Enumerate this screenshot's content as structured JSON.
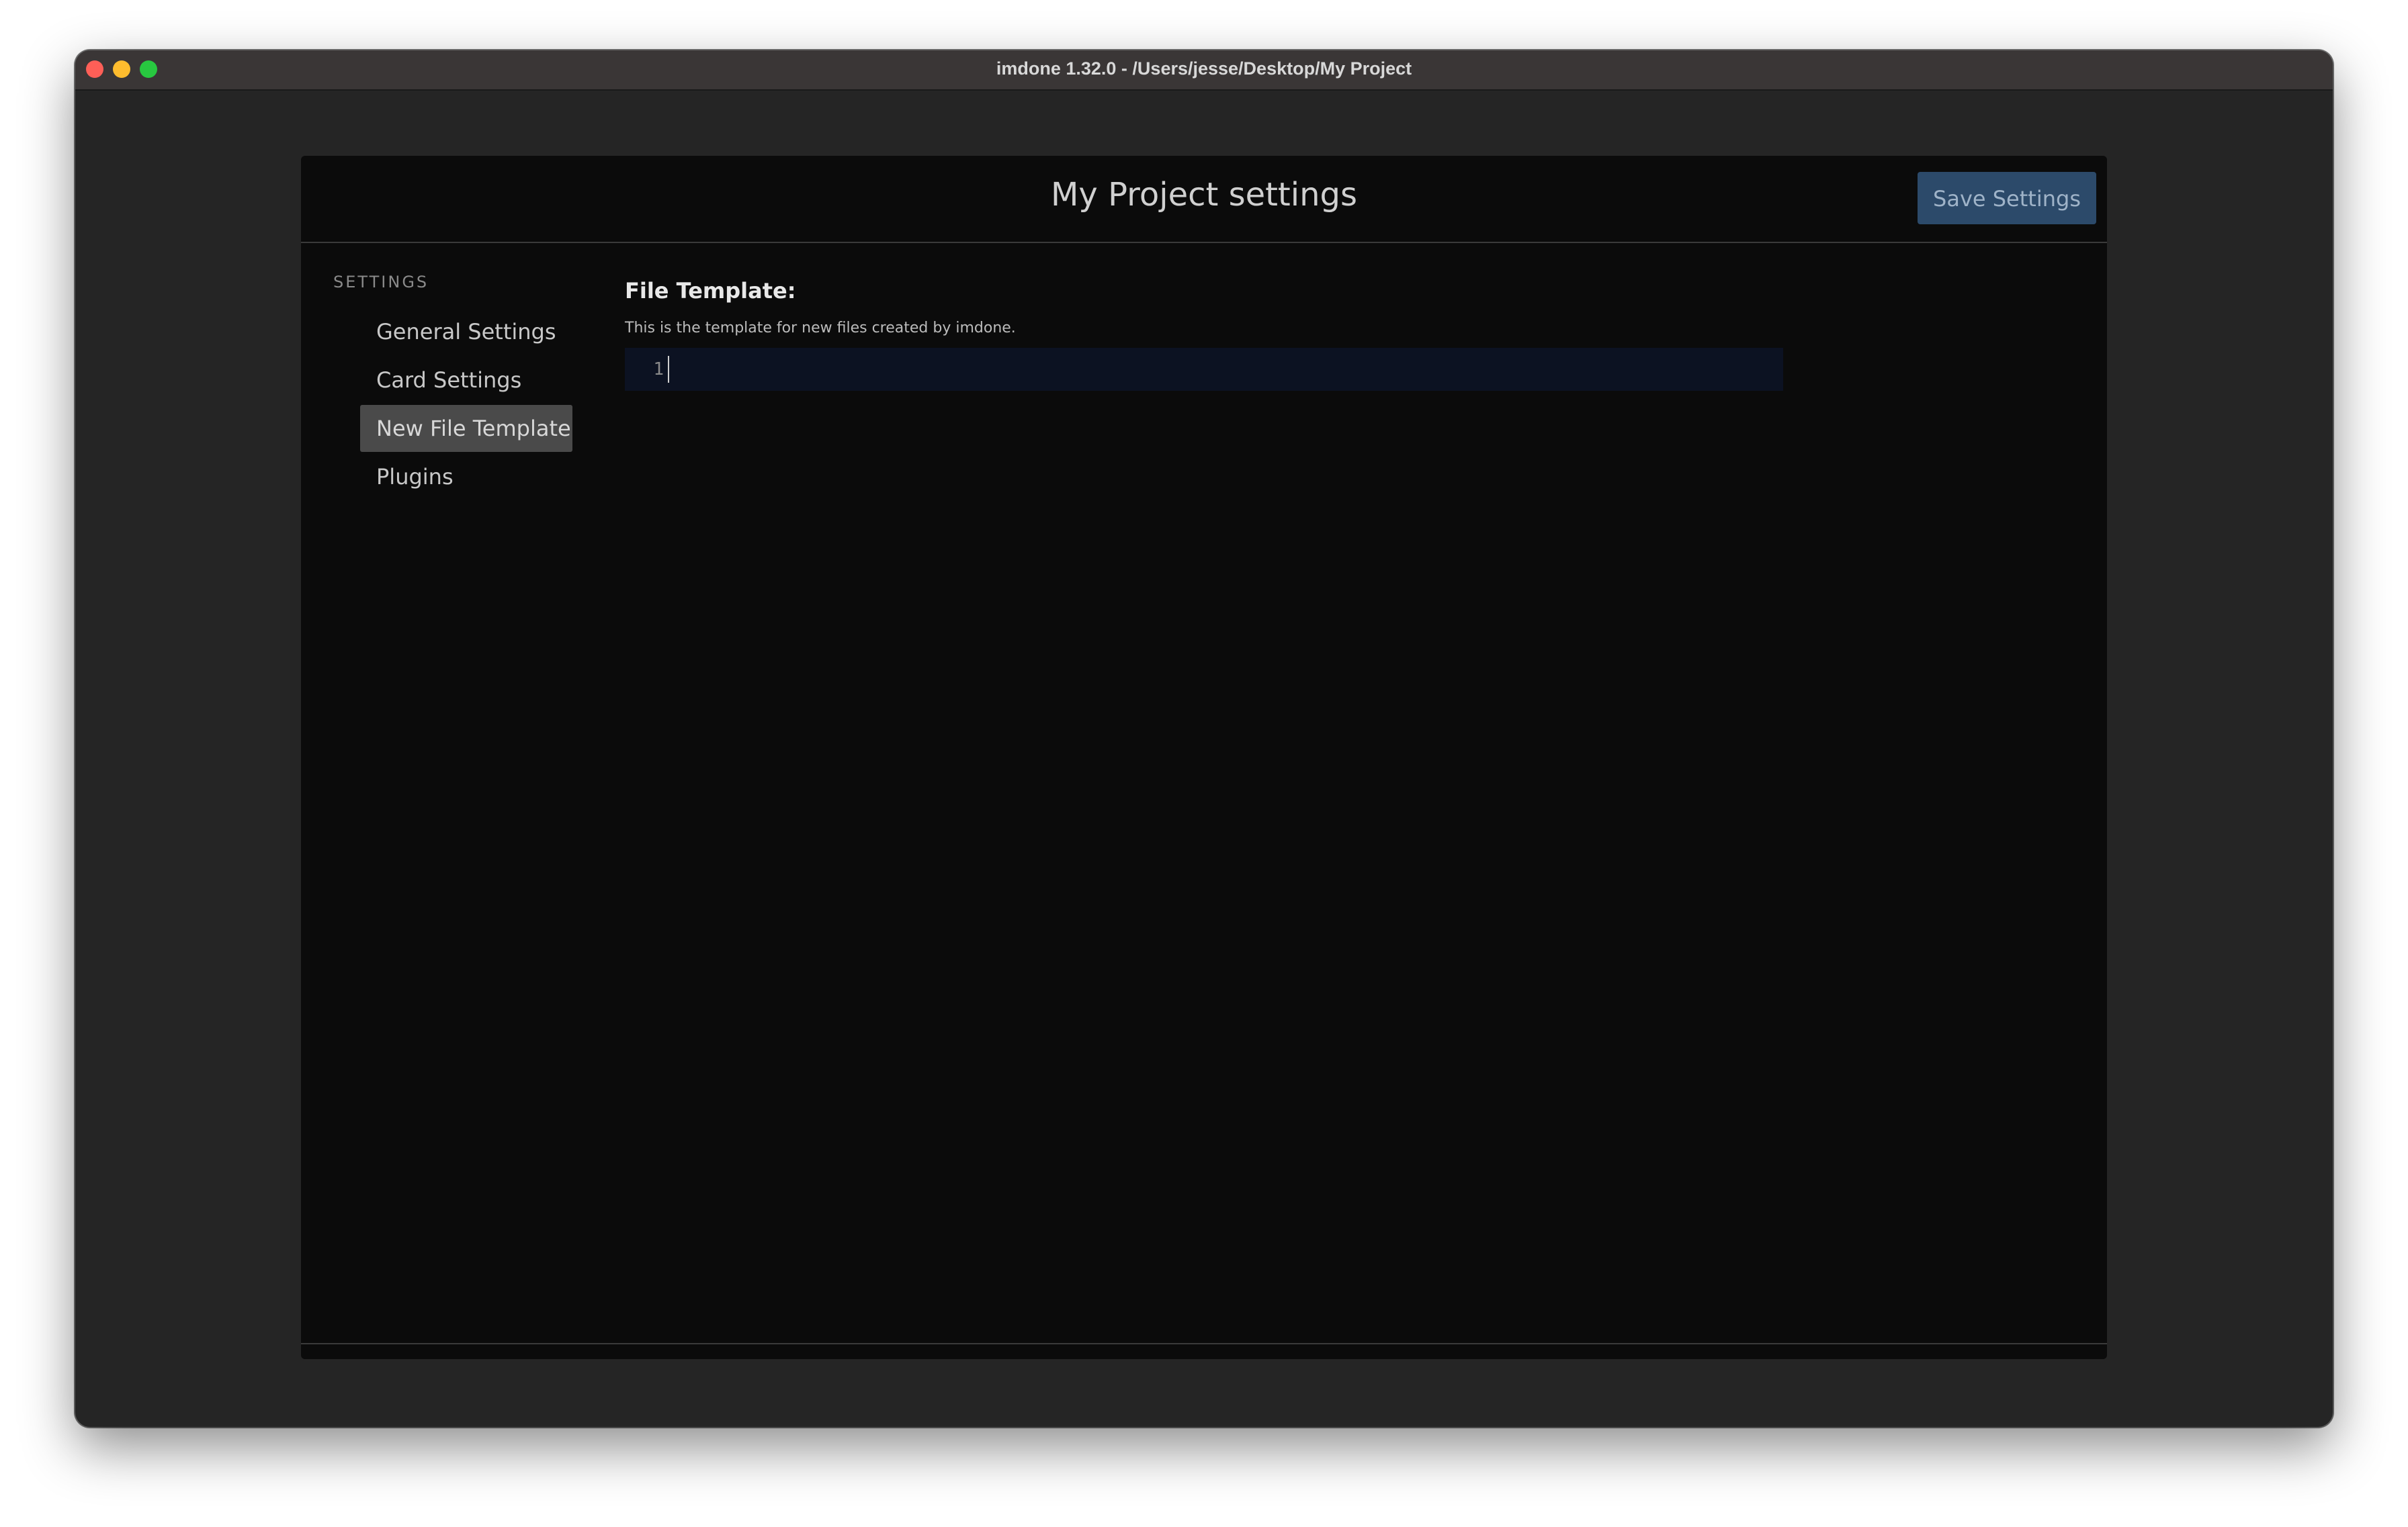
{
  "window": {
    "title": "imdone 1.32.0 - /Users/jesse/Desktop/My Project"
  },
  "modal": {
    "title": "My Project settings",
    "save_label": "Save Settings",
    "close_label": "×"
  },
  "sidebar": {
    "heading": "SETTINGS",
    "items": [
      {
        "label": "General Settings",
        "active": false
      },
      {
        "label": "Card Settings",
        "active": false
      },
      {
        "label": "New File Template",
        "active": true
      },
      {
        "label": "Plugins",
        "active": false
      }
    ]
  },
  "content": {
    "field_label": "File Template:",
    "field_help": "This is the template for new files created by imdone.",
    "editor": {
      "line_number": "1",
      "value": ""
    }
  },
  "colors": {
    "accent": "#2c4a6a",
    "background": "#0b0b0b",
    "active_nav": "#4a4a4a"
  }
}
